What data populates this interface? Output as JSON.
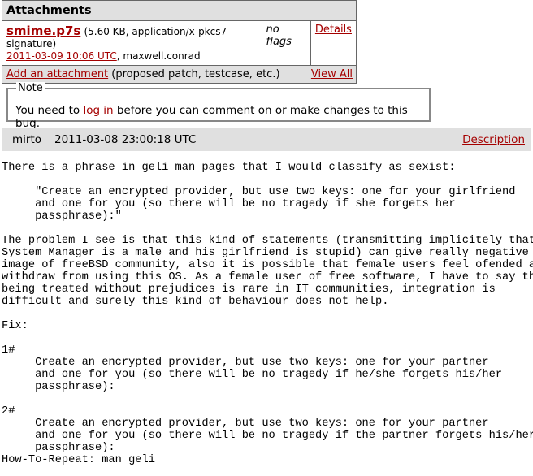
{
  "attachments": {
    "title": "Attachments",
    "items": [
      {
        "name": "smime.p7s",
        "meta": "(5.60 KB, application/x-pkcs7-signature)",
        "date": "2011-03-09 10:06 UTC",
        "author": ", maxwell.conrad",
        "flags": "no flags",
        "details": "Details"
      }
    ],
    "add_label": "Add an attachment",
    "add_hint": " (proposed patch, testcase, etc.)",
    "view_all": "View All"
  },
  "note": {
    "legend": "Note",
    "before": "You need to ",
    "link": "log in",
    "after": " before you can comment on or make changes to this bug."
  },
  "comment": {
    "author": "mirto",
    "date": "2011-03-08 23:00:18 UTC",
    "link": "Description",
    "body": "There is a phrase in geli man pages that I would classify as sexist:\n\n     \"Create an encrypted provider, but use two keys: one for your girlfriend\n     and one for you (so there will be no tragedy if she forgets her\n     passphrase):\"\n\nThe problem I see is that this kind of statements (transmitting implicitely that\nSystem Manager is a male and his girlfriend is stupid) can give really negative\nimage of freeBSD community, also it is possible that female users feel ofended and\nwithdraw from using this OS. As a female user of free software, I have to say that\nbeing treated without prejudices is rare in IT communities, integration is\ndifficult and surely this kind of behaviour does not help.\n\nFix:\n\n1#\n     Create an encrypted provider, but use two keys: one for your partner\n     and one for you (so there will be no tragedy if he/she forgets his/her\n     passphrase):\n\n2#\n     Create an encrypted provider, but use two keys: one for your partner\n     and one for you (so there will be no tragedy if the partner forgets his/her\n     passphrase):\nHow-To-Repeat: man geli"
  }
}
